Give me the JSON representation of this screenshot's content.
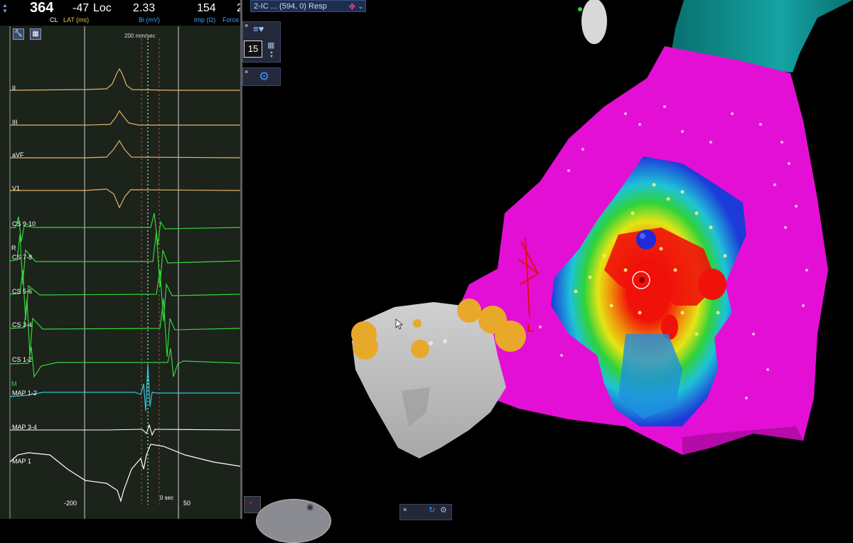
{
  "header": {
    "cycle_length_value": "364",
    "cycle_length_label": "CL",
    "lat_value": "-47",
    "lat_label": "LAT (ms)",
    "loc_label": "Loc",
    "bi_value": "2.33",
    "bi_label": "Bi (mV)",
    "imp_value": "154",
    "imp_label": "Imp (Ω)",
    "force_value": "2",
    "force_label": "Force"
  },
  "ecg": {
    "speed_label": "200 mm/sec",
    "channels": [
      {
        "label": "II",
        "color": "#e2b468"
      },
      {
        "label": "III",
        "color": "#e2b468"
      },
      {
        "label": "aVF",
        "color": "#e2b468"
      },
      {
        "label": "V1",
        "color": "#e2b468"
      },
      {
        "label": "CS 9-10",
        "color": "#37d33a"
      },
      {
        "label": "CS 7-8",
        "color": "#37d33a"
      },
      {
        "label": "CS 5-6",
        "color": "#37d33a"
      },
      {
        "label": "CS 3-4",
        "color": "#37d33a"
      },
      {
        "label": "CS 1-2",
        "color": "#37d33a"
      },
      {
        "label": "MAP 1-2",
        "color": "#2fc7d8"
      },
      {
        "label": "MAP 3-4",
        "color": "#ffffff"
      },
      {
        "label": "MAP 1",
        "color": "#ffffff"
      }
    ],
    "r_marker": "R",
    "m_marker": "M",
    "axis_minus": "-200",
    "axis_zero": "0 sec",
    "axis_plus": "50"
  },
  "map": {
    "title": "2-IC ... (594, 0) Resp",
    "zoom_value": "15",
    "close_symbol": "×",
    "annotation_letter": "L",
    "colors": {
      "magenta": "#e40fd5",
      "red": "#f0120a",
      "gray_chamber": "#bdbdbd",
      "teal_vessel": "#0c8c8c",
      "ablation_tag": "#e8a92a",
      "catheter_tip": "#1d2bd8"
    }
  },
  "icons": {
    "ecg_tools": [
      "wrench-icon",
      "grid-settings-icon"
    ],
    "map_panel": [
      "heart-list-icon",
      "grid-icon",
      "gear-icon"
    ],
    "bottom": [
      "orientation-icon",
      "rotate-icon",
      "settings-small-icon"
    ]
  }
}
